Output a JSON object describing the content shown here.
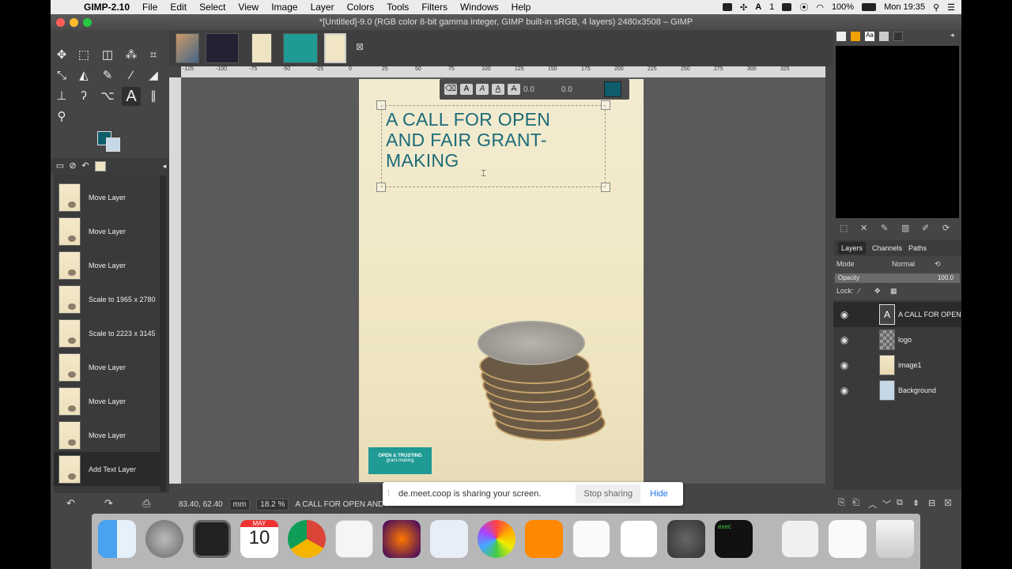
{
  "menubar": {
    "app_name": "GIMP-2.10",
    "items": [
      "File",
      "Edit",
      "Select",
      "View",
      "Image",
      "Layer",
      "Colors",
      "Tools",
      "Filters",
      "Windows",
      "Help"
    ],
    "battery": "100%",
    "clock": "Mon 19:35",
    "status_count": "1"
  },
  "window": {
    "title": "*[Untitled]-9.0 (RGB color 8-bit gamma integer, GIMP built-in sRGB, 4 layers) 2480x3508 – GIMP"
  },
  "toolbox": {
    "fg_color": "#0e5d6b",
    "bg_color": "#c6d8e6",
    "active_tool": "text-tool"
  },
  "history": {
    "items": [
      {
        "label": "Move Layer"
      },
      {
        "label": "Move Layer"
      },
      {
        "label": "Move Layer"
      },
      {
        "label": "Scale to 1965 x 2780"
      },
      {
        "label": "Scale to 2223 x 3145"
      },
      {
        "label": "Move Layer"
      },
      {
        "label": "Move Layer"
      },
      {
        "label": "Move Layer"
      },
      {
        "label": "Add Text Layer"
      }
    ]
  },
  "ruler": {
    "ticks": [
      "-125",
      "-100",
      "-75",
      "-50",
      "-25",
      "0",
      "25",
      "50",
      "75",
      "100",
      "125",
      "150",
      "175",
      "200",
      "225",
      "250",
      "275",
      "300",
      "325"
    ]
  },
  "canvas": {
    "headline": [
      "A CALL FOR OPEN",
      "AND FAIR GRANT-",
      "MAKING"
    ],
    "style_offset_1": "0.0",
    "style_offset_2": "0.0",
    "text_color": "#1b6b7a",
    "logo_title": "OPEN & TRUSTING",
    "logo_subtitle": "grant-making"
  },
  "statusbar": {
    "coords": "83.40, 62.40",
    "unit": "mm",
    "zoom": "18.2 %",
    "layer_name": "A CALL FOR OPEN AND F"
  },
  "share": {
    "message": "de.meet.coop is sharing your screen.",
    "stop_label": "Stop sharing",
    "hide_label": "Hide"
  },
  "layers_panel": {
    "tabs": [
      "Layers",
      "Channels",
      "Paths"
    ],
    "mode_label": "Mode",
    "mode_value": "Normal",
    "opacity_label": "Opacity",
    "opacity_value": "100.0",
    "lock_label": "Lock:",
    "layers": [
      {
        "name": "A CALL FOR OPEN",
        "kind": "text"
      },
      {
        "name": "logo",
        "kind": "transparent"
      },
      {
        "name": "image1",
        "kind": "image"
      },
      {
        "name": "Background",
        "kind": "fill"
      }
    ]
  },
  "dock": {
    "calendar_month": "MAY",
    "calendar_day": "10",
    "exec_label": "exec"
  }
}
